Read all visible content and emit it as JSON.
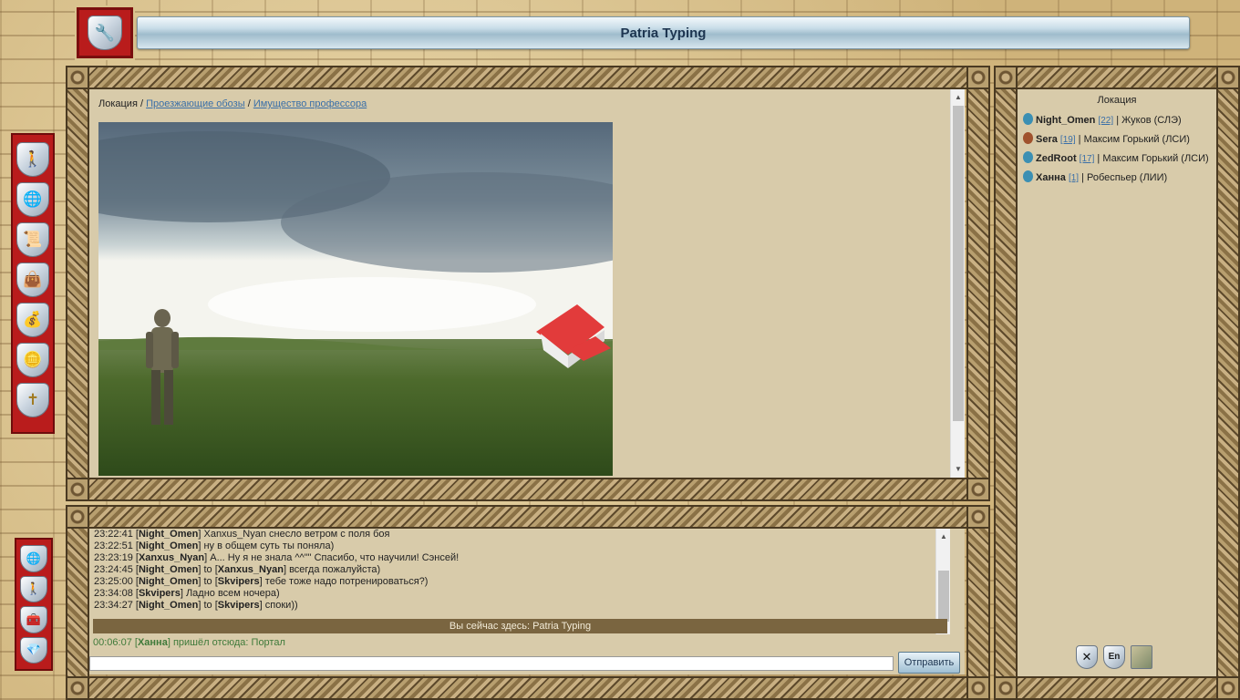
{
  "header": {
    "title": "Patria Typing"
  },
  "left_menu": {
    "items": [
      "character-icon",
      "globe-icon",
      "scroll-icon",
      "bag-icon",
      "money-bag-icon",
      "coins-icon",
      "signpost-icon"
    ],
    "bottom_items": [
      "globe-icon",
      "character-icon",
      "chest-icon",
      "diamond-icon"
    ]
  },
  "breadcrumb": {
    "root": "Локация",
    "sep": "/",
    "link1": "Проезжающие обозы",
    "link2": "Имущество профессора"
  },
  "location_panel": {
    "title": "Локация",
    "players": [
      {
        "name": "Night_Omen",
        "level": "[22]",
        "info": "| Жуков (СЛЭ)",
        "gender_color": "#3b8fb3"
      },
      {
        "name": "Sera",
        "level": "[19]",
        "info": "| Максим Горький (ЛСИ)",
        "gender_color": "#a0522d"
      },
      {
        "name": "ZedRoot",
        "level": "[17]",
        "info": "| Максим Горький (ЛСИ)",
        "gender_color": "#3b8fb3"
      },
      {
        "name": "Ханна",
        "level": "[1]",
        "info": "| Робеспьер (ЛИИ)",
        "gender_color": "#3b8fb3"
      }
    ]
  },
  "chat": {
    "messages": [
      {
        "time": "23:22:41",
        "from": "Night_Omen",
        "to": "",
        "text": "Xanxus_Nyan снесло ветром с поля боя"
      },
      {
        "time": "23:22:51",
        "from": "Night_Omen",
        "to": "",
        "text": "ну в общем суть ты поняла)"
      },
      {
        "time": "23:23:19",
        "from": "Xanxus_Nyan",
        "to": "",
        "text": "А... Ну я не знала ^^\"\" Спасибо, что научили! Сэнсей!"
      },
      {
        "time": "23:24:45",
        "from": "Night_Omen",
        "to": "Xanxus_Nyan",
        "text": "всегда пожалуйста)"
      },
      {
        "time": "23:25:00",
        "from": "Night_Omen",
        "to": "Skvipers",
        "text": "тебе тоже надо потренироваться?)"
      },
      {
        "time": "23:34:08",
        "from": "Skvipers",
        "to": "",
        "text": "Ладно всем ночера)"
      },
      {
        "time": "23:34:27",
        "from": "Night_Omen",
        "to": "Skvipers",
        "text": "споки))"
      }
    ],
    "to_word": "to",
    "here_bar": "Вы сейчас здесь: Patria Typing",
    "system": {
      "time": "00:06:07",
      "name": "Ханна",
      "text": "пришёл отсюда: Портал"
    },
    "input_value": "",
    "send_label": "Отправить"
  },
  "tools": {
    "close_label": "✕",
    "lang_label": "En"
  }
}
